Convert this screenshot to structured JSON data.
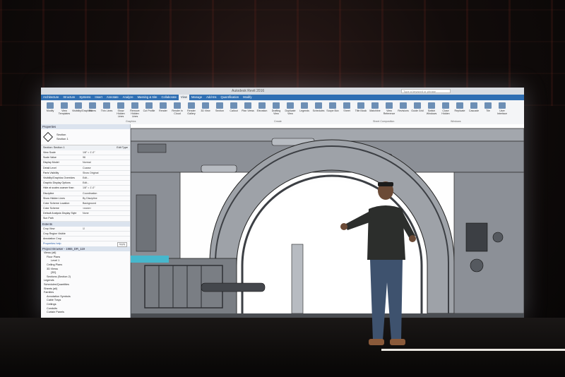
{
  "software": {
    "window_title": "Autodesk Revit 2016",
    "search_placeholder": "Type a keyword or phrase",
    "tabs": [
      "Architecture",
      "Structure",
      "Systems",
      "Insert",
      "Annotate",
      "Analyze",
      "Massing & Site",
      "Collaborate",
      "View",
      "Manage",
      "Add-Ins",
      "Quantification",
      "Modify"
    ],
    "active_tab": "View",
    "ribbon_buttons": [
      "Modify",
      "View Templates",
      "Visibility/Graphics",
      "Filters",
      "Thin Lines",
      "Show Hidden Lines",
      "Remove Hidden Lines",
      "Cut Profile",
      "Render",
      "Render in Cloud",
      "Render Gallery",
      "3D View",
      "Section",
      "Callout",
      "Plan Views",
      "Elevation",
      "Drafting View",
      "Duplicate View",
      "Legends",
      "Schedules",
      "Scope Box",
      "Sheet",
      "Title Block",
      "Matchline",
      "View Reference",
      "Revisions",
      "Guide Grid",
      "Switch Windows",
      "Close Hidden",
      "Replicate",
      "Cascade",
      "Tile",
      "User Interface"
    ],
    "ribbon_groups": [
      "Graphics",
      "Create",
      "Sheet Composition",
      "Windows"
    ],
    "properties": {
      "header": "Properties",
      "type_line1": "Section",
      "type_line2": "Section 1",
      "selector": "Section: Section 1",
      "edit_type": "Edit Type",
      "rows": [
        {
          "k": "View Scale",
          "v": "1/8\" = 1'-0\""
        },
        {
          "k": "Scale Value",
          "v": "96"
        },
        {
          "k": "Display Model",
          "v": "Normal"
        },
        {
          "k": "Detail Level",
          "v": "Coarse"
        },
        {
          "k": "Parts Visibility",
          "v": "Show Original"
        },
        {
          "k": "Visibility/Graphics Overrides",
          "v": "Edit..."
        },
        {
          "k": "Graphic Display Options",
          "v": "Edit..."
        },
        {
          "k": "Hide at scales coarser than",
          "v": "1/8\" = 1'-0\""
        },
        {
          "k": "Discipline",
          "v": "Coordination"
        },
        {
          "k": "Show Hidden Lines",
          "v": "By Discipline"
        },
        {
          "k": "Color Scheme Location",
          "v": "Background"
        },
        {
          "k": "Color Scheme",
          "v": "<none>"
        },
        {
          "k": "Default Analysis Display Style",
          "v": "None"
        },
        {
          "k": "Sun Path",
          "v": ""
        }
      ],
      "extents_header": "Extents",
      "extents_rows": [
        {
          "k": "Crop View",
          "v": "☑"
        },
        {
          "k": "Crop Region Visible",
          "v": ""
        },
        {
          "k": "Annotation Crop",
          "v": ""
        }
      ],
      "help_link": "Properties help",
      "apply": "Apply"
    },
    "project_browser": {
      "header": "Project Browser - 1965_DR_119",
      "items": [
        "Views (all)",
        "Floor Plans",
        "Level 1",
        "Ceiling Plans",
        "3D Views",
        "{3D}",
        "Sections (Section 2)",
        "Legends",
        "Schedules/Quantities",
        "Sheets (all)",
        "Families",
        "Annotation Symbols",
        "Cable Trays",
        "Ceilings",
        "Conduits",
        "Curtain Panels"
      ]
    }
  },
  "colors": {
    "ribbon_blue": "#2f6fb3",
    "drawing_gray": "#8c9097",
    "drawing_dark": "#3c3f44",
    "highlight_cyan": "#46b7cc",
    "presenter_shirt": "#2c2e2c",
    "presenter_jeans": "#3e526e",
    "shoes": "#8a5a3a"
  }
}
